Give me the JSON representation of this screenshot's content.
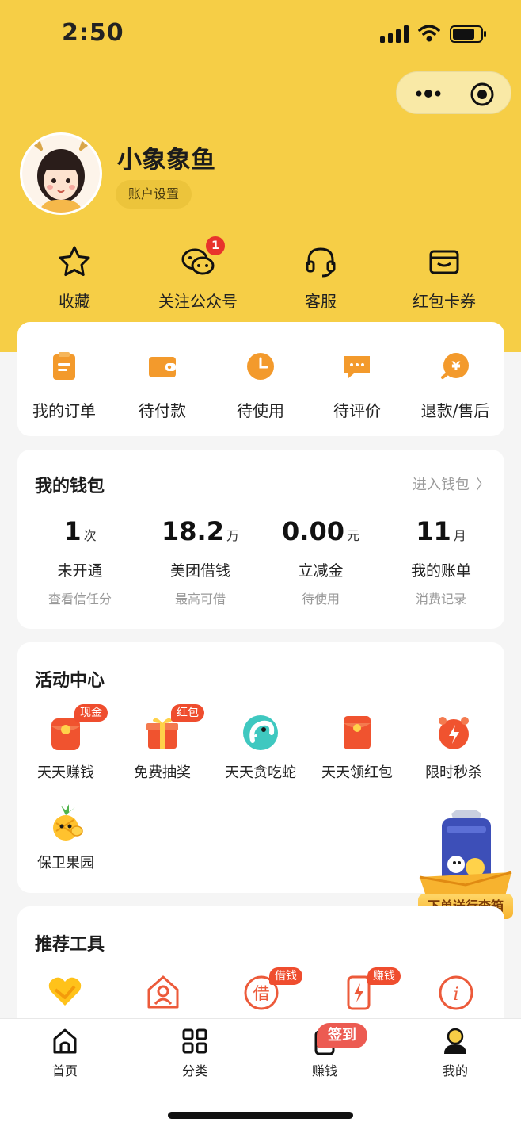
{
  "status_bar": {
    "time": "2:50"
  },
  "profile": {
    "name": "小象象鱼",
    "settings_label": "账户设置"
  },
  "quick_links": [
    {
      "label": "收藏",
      "icon": "star-icon"
    },
    {
      "label": "关注公众号",
      "icon": "wechat-icon",
      "badge": "1"
    },
    {
      "label": "客服",
      "icon": "headset-icon"
    },
    {
      "label": "红包卡券",
      "icon": "wallet-card-icon"
    }
  ],
  "orders": [
    {
      "label": "我的订单",
      "icon": "order-clipboard-icon"
    },
    {
      "label": "待付款",
      "icon": "wallet-icon"
    },
    {
      "label": "待使用",
      "icon": "clock-icon"
    },
    {
      "label": "待评价",
      "icon": "comment-icon"
    },
    {
      "label": "退款/售后",
      "icon": "refund-icon"
    }
  ],
  "wallet": {
    "title": "我的钱包",
    "more_label": "进入钱包",
    "items": [
      {
        "value": "1",
        "unit": "次",
        "label": "未开通",
        "sub": "查看信任分"
      },
      {
        "value": "18.2",
        "unit": "万",
        "label": "美团借钱",
        "sub": "最高可借"
      },
      {
        "value": "0.00",
        "unit": "元",
        "label": "立减金",
        "sub": "待使用"
      },
      {
        "value": "11",
        "unit": "月",
        "label": "我的账单",
        "sub": "消费记录"
      }
    ]
  },
  "activities": {
    "title": "活动中心",
    "items": [
      {
        "label": "天天赚钱",
        "tag": "现金",
        "icon": "red-envelope-coin-icon"
      },
      {
        "label": "免费抽奖",
        "tag": "红包",
        "icon": "gift-box-icon"
      },
      {
        "label": "天天贪吃蛇",
        "tag": "",
        "icon": "snake-icon"
      },
      {
        "label": "天天领红包",
        "tag": "",
        "icon": "red-envelope-icon"
      },
      {
        "label": "限时秒杀",
        "tag": "",
        "icon": "flash-alarm-icon"
      },
      {
        "label": "保卫果园",
        "tag": "",
        "icon": "pineapple-icon"
      }
    ]
  },
  "promo": {
    "label": "下单送行李箱"
  },
  "tools": {
    "title": "推荐工具",
    "items": [
      {
        "tag": "",
        "icon": "yellow-heart-icon"
      },
      {
        "tag": "",
        "icon": "house-user-icon"
      },
      {
        "tag": "借钱",
        "icon": "borrow-icon",
        "glyph": "借"
      },
      {
        "tag": "赚钱",
        "icon": "phone-lightning-icon"
      },
      {
        "tag": "",
        "icon": "info-icon",
        "glyph": "i"
      }
    ]
  },
  "tabbar": {
    "items": [
      {
        "label": "首页",
        "icon": "home-icon"
      },
      {
        "label": "分类",
        "icon": "grid-icon"
      },
      {
        "label": "赚钱",
        "icon": "earn-icon"
      },
      {
        "label": "我的",
        "icon": "user-icon"
      }
    ],
    "signin_label": "签到"
  },
  "colors": {
    "brand_yellow": "#f6ce46",
    "accent_orange": "#f39a2c",
    "tag_red": "#ef4d2e"
  }
}
